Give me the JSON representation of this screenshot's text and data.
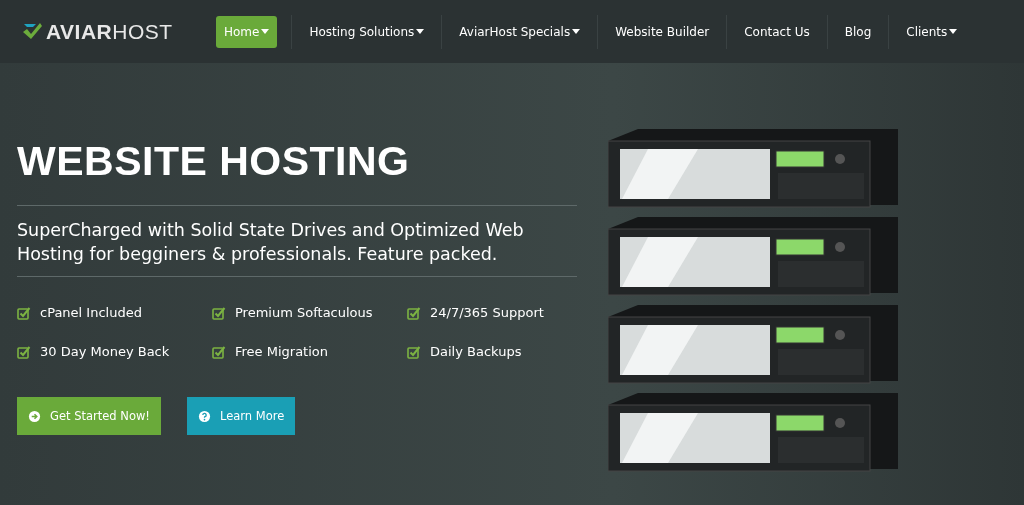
{
  "logo": {
    "text": "**AVIAR**HOST"
  },
  "nav": [
    {
      "label": "Home",
      "selected": true,
      "dropdown": true
    },
    {
      "label": "Hosting Solutions",
      "selected": false,
      "dropdown": true
    },
    {
      "label": "AviarHost Specials",
      "selected": false,
      "dropdown": true
    },
    {
      "label": "Website Builder",
      "selected": false,
      "dropdown": false
    },
    {
      "label": "Contact Us",
      "selected": false,
      "dropdown": false
    },
    {
      "label": "Blog",
      "selected": false,
      "dropdown": false
    },
    {
      "label": "Clients",
      "selected": false,
      "dropdown": true
    }
  ],
  "hero": {
    "title": "WEBSITE HOSTING",
    "subtitle": "SuperCharged with Solid State Drives and Optimized Web Hosting for begginers & professionals. Feature packed.",
    "features": [
      "cPanel Included",
      "Premium Softaculous",
      "24/7/365 Support",
      "30 Day Money Back",
      "Free Migration",
      "Daily Backups"
    ],
    "buttons": [
      {
        "label": "Get Started Now!",
        "kind": "primary"
      },
      {
        "label": "Learn More",
        "kind": "info"
      }
    ]
  }
}
